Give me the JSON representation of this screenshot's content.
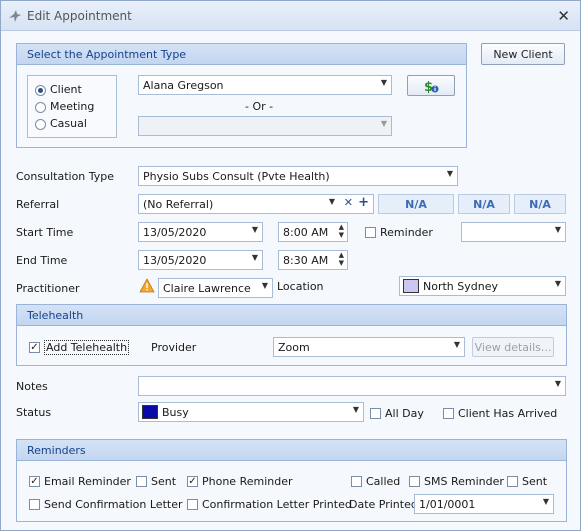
{
  "window": {
    "title": "Edit Appointment",
    "close_glyph": "✕"
  },
  "appointment_type": {
    "header": "Select the Appointment Type",
    "options": [
      "Client",
      "Meeting",
      "Casual"
    ],
    "selected": "Client",
    "client_name": "Alana Gregson",
    "or_label": "- Or -",
    "secondary_value": ""
  },
  "new_client_label": "New Client",
  "form": {
    "consultation_label": "Consultation Type",
    "consultation_value": "Physio Subs Consult (Pvte Health)",
    "referral_label": "Referral",
    "referral_value": "(No Referral)",
    "referral_clear_glyph": "✕",
    "referral_add_glyph": "+",
    "na_buttons": [
      "N/A",
      "N/A",
      "N/A"
    ],
    "start_label": "Start Time",
    "start_date": "13/05/2020",
    "start_time": "8:00 AM",
    "reminder_label": "Reminder",
    "reminder_value": "",
    "end_label": "End Time",
    "end_date": "13/05/2020",
    "end_time": "8:30 AM",
    "practitioner_label": "Practitioner",
    "practitioner_value": "Claire Lawrence",
    "location_label": "Location",
    "location_value": "North Sydney",
    "location_color": "#c9c6f2"
  },
  "telehealth": {
    "header": "Telehealth",
    "add_label": "Add Telehealth",
    "add_checked": true,
    "provider_label": "Provider",
    "provider_value": "Zoom",
    "view_details_label": "View details..."
  },
  "notes": {
    "label": "Notes",
    "value": ""
  },
  "status": {
    "label": "Status",
    "value": "Busy",
    "color": "#0a0aa8",
    "all_day_label": "All Day",
    "client_arrived_label": "Client Has Arrived"
  },
  "reminders": {
    "header": "Reminders",
    "email_reminder": "Email Reminder",
    "sent_1": "Sent",
    "phone_reminder": "Phone Reminder",
    "called": "Called",
    "sms_reminder": "SMS Reminder",
    "sent_2": "Sent",
    "send_confirmation": "Send Confirmation Letter",
    "confirmation_printed": "Confirmation Letter Printed",
    "date_printed_label": "Date Printed",
    "date_printed_value": "1/01/0001"
  },
  "icons": {
    "title": "bird-logo-icon",
    "billing": "dollar-info-icon",
    "warning": "warning-icon"
  },
  "check_glyph": "✓",
  "arrow_glyph": "▼"
}
